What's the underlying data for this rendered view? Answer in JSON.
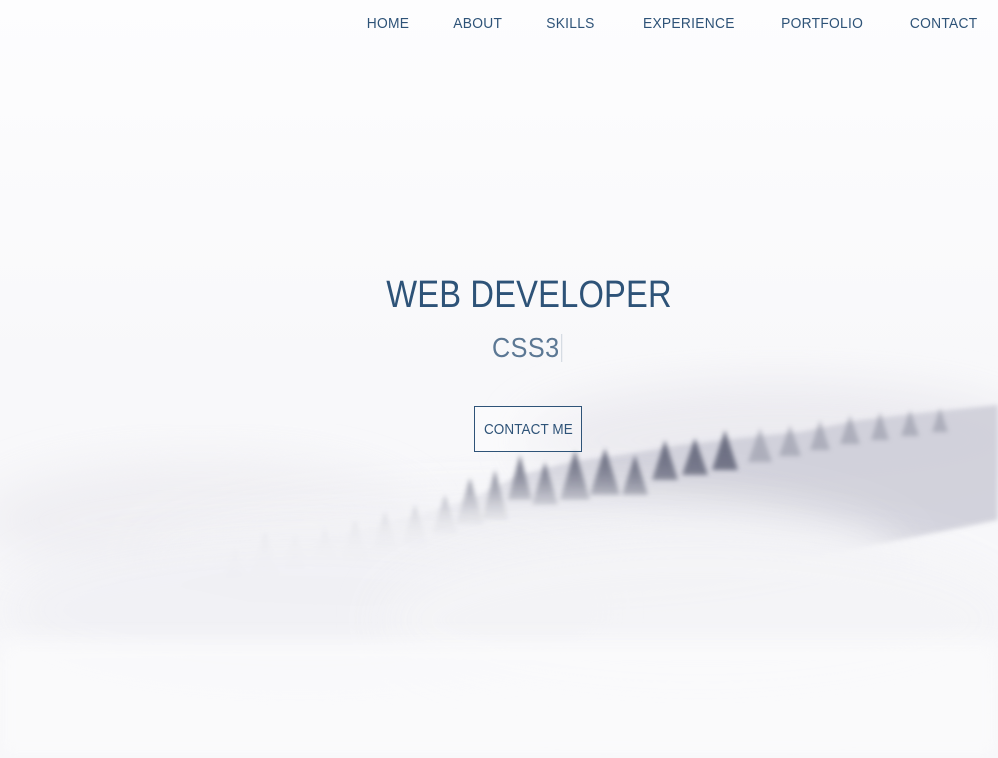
{
  "nav": {
    "items": [
      {
        "label": "HOME"
      },
      {
        "label": "ABOUT"
      },
      {
        "label": "SKILLS"
      },
      {
        "label": "EXPERIENCE"
      },
      {
        "label": "PORTFOLIO"
      },
      {
        "label": "CONTACT"
      }
    ]
  },
  "hero": {
    "title": "WEB DEVELOPER",
    "typed_text": "CSS3",
    "cta_label": "CONTACT ME"
  },
  "colors": {
    "accent": "#2e5378",
    "background": "#fafafb",
    "fog": "#e6e5ec",
    "trees": "#575b6e"
  },
  "icons": {
    "background": "misty-forest-image",
    "cursor": "text-cursor-icon"
  }
}
